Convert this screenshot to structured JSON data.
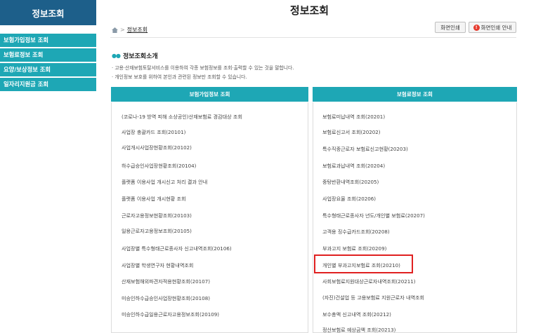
{
  "sidebar": {
    "title": "정보조회",
    "items": [
      {
        "label": "보험가입정보 조회"
      },
      {
        "label": "보험료정보 조회"
      },
      {
        "label": "요양/보상정보 조회"
      },
      {
        "label": "일자리지원금 조회"
      }
    ]
  },
  "header": {
    "title": "정보조회",
    "breadcrumb_current": "정보조회",
    "print_button": "화면인쇄",
    "print_guide_button": "화면인쇄 안내",
    "warn_glyph": "!"
  },
  "intro": {
    "title": "정보조회소개",
    "line1": "· 고용·산재보험토탈서비스를 이용하여 각종 보험정보를 조회·출력할 수 있는 것을 말합니다.",
    "line2": "· 개인정보 보호를 위하여 본인과 관련된 정보만 조회할 수 있습니다."
  },
  "left_column": {
    "header": "보험가입정보 조회",
    "items": [
      {
        "label": "(코로나-19 방역 피해 소상공인)산재보험료 경감대상 조회"
      },
      {
        "label": "사업장 총괄카드 조회(20101)"
      },
      {
        "label": "사업개시사업장현황조회(20102)"
      },
      {
        "label": "하수급승인사업장현황조회(20104)"
      },
      {
        "label": "플랫폼 이용사업 개시신고 처리 결과 안내"
      },
      {
        "label": "플랫폼 이용사업 개시현황 조회"
      },
      {
        "label": "근로자고용정보현황조회(20103)"
      },
      {
        "label": "일용근로자고용정보조회(20105)"
      },
      {
        "label": "사업장별 특수형태근로종사자 신고내역조회(20106)"
      },
      {
        "label": "사업장별 학생연구자 현황내역조회"
      },
      {
        "label": "산재보험해외파견자적용현황조회(20107)"
      },
      {
        "label": "미승인하수급승인사업장현황조회(20108)"
      },
      {
        "label": "미승인하수급일용근로자고용정보조회(20109)"
      }
    ]
  },
  "right_column": {
    "header": "보험료정보 조회",
    "items": [
      {
        "label": "보험료미납내역 조회(20201)"
      },
      {
        "label": "보험료신고서 조회(20202)"
      },
      {
        "label": "특수직종근로자 보험료신고현황(20203)"
      },
      {
        "label": "보험료과납내역 조회(20204)"
      },
      {
        "label": "중탕반환내역조회(20205)"
      },
      {
        "label": "사업장요율 조회(20206)"
      },
      {
        "label": "특수형태근로종사자 년도/개인별 보험료(20207)"
      },
      {
        "label": "고객용 징수급카드조회(20208)"
      },
      {
        "label": "부과고지 보험료 조회(20209)"
      },
      {
        "label": "개인별 부과고지보험료 조회(20210)"
      },
      {
        "label": "사회보험료지원대상근로자내역조회(20211)"
      },
      {
        "label": "(자진)건설업 등 고용보험료 지원근로자 내역조회"
      },
      {
        "label": "보수총액 신고내역 조회(20212)"
      },
      {
        "label": "정산보험료 예상금액 조회(20213)"
      }
    ]
  },
  "colors": {
    "sidebar_title_bg": "#1d5f8a",
    "teal": "#1ea7b5",
    "highlight": "#e02020"
  }
}
